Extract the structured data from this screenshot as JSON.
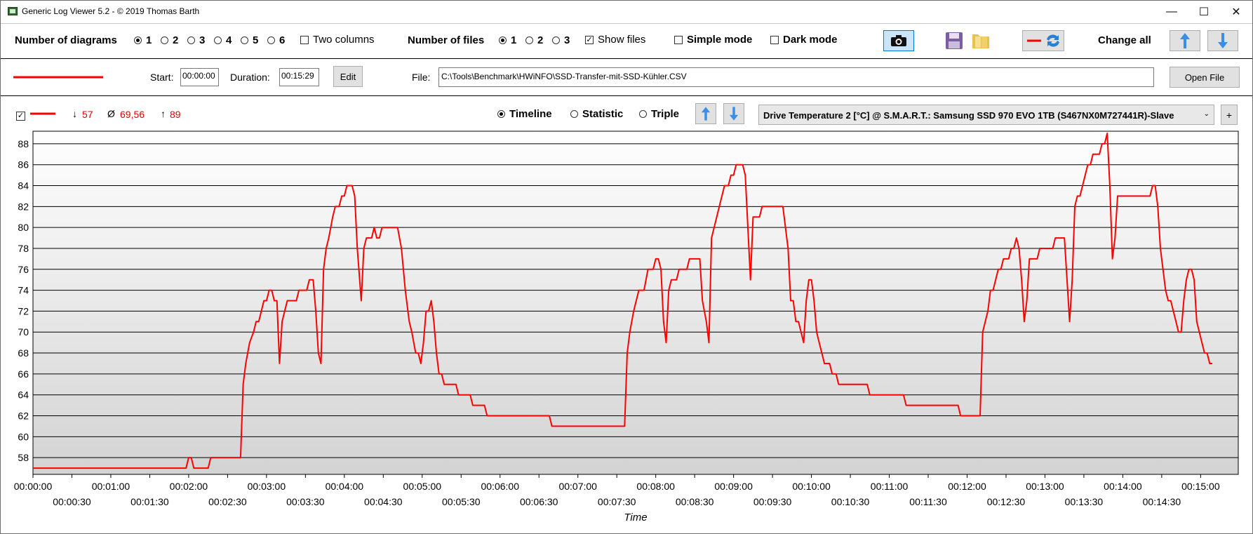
{
  "window": {
    "title": "Generic Log Viewer 5.2 - © 2019 Thomas Barth",
    "minimize": "—",
    "maximize": "☐",
    "close": "✕"
  },
  "toolbar": {
    "diagrams_label": "Number of diagrams",
    "diagram_options": [
      "1",
      "2",
      "3",
      "4",
      "5",
      "6"
    ],
    "diagram_selected": "1",
    "two_columns": "Two columns",
    "files_label": "Number of files",
    "file_options": [
      "1",
      "2",
      "3"
    ],
    "file_selected": "1",
    "show_files": "Show files",
    "simple_mode": "Simple mode",
    "dark_mode": "Dark mode",
    "change_all": "Change all",
    "icons": [
      "camera-icon",
      "save-icon",
      "folder-icon",
      "swap-color-icon",
      "arrow-up-icon",
      "arrow-down-icon"
    ]
  },
  "file_row": {
    "start_label": "Start:",
    "start_value": "00:00:00",
    "duration_label": "Duration:",
    "duration_value": "00:15:29",
    "edit": "Edit",
    "file_label": "File:",
    "file_path": "C:\\Tools\\Benchmark\\HWiNFO\\SSD-Transfer-mit-SSD-Kühler.CSV",
    "open_file": "Open File",
    "line_color": "#ff0000"
  },
  "series_row": {
    "min": "57",
    "avg": "69,56",
    "max": "89",
    "min_icon": "↓",
    "avg_icon": "Ø",
    "max_icon": "↑",
    "views": [
      "Timeline",
      "Statistic",
      "Triple"
    ],
    "view_selected": "Timeline",
    "sensor": "Drive Temperature 2 [°C] @ S.M.A.R.T.: Samsung SSD 970 EVO 1TB (S467NX0M727441R)-Slave",
    "add": "+"
  },
  "chart_data": {
    "type": "line",
    "xlabel": "Time",
    "ylabel": "",
    "ylim": [
      56.4,
      89.2
    ],
    "xlim_seconds": [
      0,
      929
    ],
    "y_ticks": [
      58,
      60,
      62,
      64,
      66,
      68,
      70,
      72,
      74,
      76,
      78,
      80,
      82,
      84,
      86,
      88
    ],
    "x_ticks_top": [
      "00:00:00",
      "00:01:00",
      "00:02:00",
      "00:03:00",
      "00:04:00",
      "00:05:00",
      "00:06:00",
      "00:07:00",
      "00:08:00",
      "00:09:00",
      "00:10:00",
      "00:11:00",
      "00:12:00",
      "00:13:00",
      "00:14:00",
      "00:15:00"
    ],
    "x_ticks_bottom": [
      "00:00:30",
      "00:01:30",
      "00:02:30",
      "00:03:30",
      "00:04:30",
      "00:05:30",
      "00:06:30",
      "00:07:30",
      "00:08:30",
      "00:09:30",
      "00:10:30",
      "00:11:30",
      "00:12:30",
      "00:13:30",
      "00:14:30"
    ],
    "grid": true,
    "series": [
      {
        "color": "#ff0000",
        "points": [
          [
            0,
            57
          ],
          [
            118,
            57
          ],
          [
            120,
            58
          ],
          [
            122,
            58
          ],
          [
            124,
            57
          ],
          [
            135,
            57
          ],
          [
            137,
            58
          ],
          [
            160,
            58
          ],
          [
            162,
            65
          ],
          [
            164,
            67
          ],
          [
            167,
            69
          ],
          [
            170,
            70
          ],
          [
            172,
            71
          ],
          [
            174,
            71
          ],
          [
            176,
            72
          ],
          [
            178,
            73
          ],
          [
            180,
            73
          ],
          [
            182,
            74
          ],
          [
            184,
            74
          ],
          [
            186,
            73
          ],
          [
            188,
            73
          ],
          [
            190,
            67
          ],
          [
            192,
            71
          ],
          [
            194,
            72
          ],
          [
            196,
            73
          ],
          [
            203,
            73
          ],
          [
            205,
            74
          ],
          [
            211,
            74
          ],
          [
            213,
            75
          ],
          [
            216,
            75
          ],
          [
            218,
            72
          ],
          [
            220,
            68
          ],
          [
            222,
            67
          ],
          [
            224,
            76
          ],
          [
            226,
            78
          ],
          [
            228,
            79
          ],
          [
            231,
            81
          ],
          [
            233,
            82
          ],
          [
            236,
            82
          ],
          [
            238,
            83
          ],
          [
            240,
            83
          ],
          [
            242,
            84
          ],
          [
            246,
            84
          ],
          [
            248,
            83
          ],
          [
            250,
            78
          ],
          [
            253,
            73
          ],
          [
            255,
            78
          ],
          [
            257,
            79
          ],
          [
            261,
            79
          ],
          [
            263,
            80
          ],
          [
            265,
            79
          ],
          [
            267,
            79
          ],
          [
            269,
            80
          ],
          [
            281,
            80
          ],
          [
            284,
            78
          ],
          [
            287,
            74
          ],
          [
            290,
            71
          ],
          [
            292,
            70
          ],
          [
            295,
            68
          ],
          [
            297,
            68
          ],
          [
            299,
            67
          ],
          [
            301,
            69
          ],
          [
            303,
            72
          ],
          [
            305,
            72
          ],
          [
            307,
            73
          ],
          [
            309,
            71
          ],
          [
            311,
            68
          ],
          [
            313,
            66
          ],
          [
            315,
            66
          ],
          [
            317,
            65
          ],
          [
            326,
            65
          ],
          [
            328,
            64
          ],
          [
            337,
            64
          ],
          [
            339,
            63
          ],
          [
            348,
            63
          ],
          [
            350,
            62
          ],
          [
            398,
            62
          ],
          [
            400,
            61
          ],
          [
            456,
            61
          ],
          [
            458,
            68
          ],
          [
            460,
            70
          ],
          [
            463,
            72
          ],
          [
            467,
            74
          ],
          [
            471,
            74
          ],
          [
            474,
            76
          ],
          [
            478,
            76
          ],
          [
            480,
            77
          ],
          [
            482,
            77
          ],
          [
            484,
            76
          ],
          [
            486,
            71
          ],
          [
            488,
            69
          ],
          [
            490,
            74
          ],
          [
            492,
            75
          ],
          [
            496,
            75
          ],
          [
            498,
            76
          ],
          [
            504,
            76
          ],
          [
            506,
            77
          ],
          [
            514,
            77
          ],
          [
            516,
            73
          ],
          [
            519,
            71
          ],
          [
            521,
            69
          ],
          [
            523,
            79
          ],
          [
            525,
            80
          ],
          [
            527,
            81
          ],
          [
            529,
            82
          ],
          [
            531,
            83
          ],
          [
            533,
            84
          ],
          [
            536,
            84
          ],
          [
            538,
            85
          ],
          [
            540,
            85
          ],
          [
            542,
            86
          ],
          [
            547,
            86
          ],
          [
            549,
            85
          ],
          [
            551,
            80
          ],
          [
            553,
            75
          ],
          [
            555,
            81
          ],
          [
            560,
            81
          ],
          [
            562,
            82
          ],
          [
            578,
            82
          ],
          [
            580,
            80
          ],
          [
            582,
            78
          ],
          [
            584,
            73
          ],
          [
            586,
            73
          ],
          [
            588,
            71
          ],
          [
            590,
            71
          ],
          [
            592,
            70
          ],
          [
            594,
            69
          ],
          [
            596,
            73
          ],
          [
            598,
            75
          ],
          [
            600,
            75
          ],
          [
            602,
            73
          ],
          [
            604,
            70
          ],
          [
            606,
            69
          ],
          [
            608,
            68
          ],
          [
            610,
            67
          ],
          [
            614,
            67
          ],
          [
            616,
            66
          ],
          [
            619,
            66
          ],
          [
            621,
            65
          ],
          [
            643,
            65
          ],
          [
            645,
            64
          ],
          [
            671,
            64
          ],
          [
            673,
            63
          ],
          [
            713,
            63
          ],
          [
            715,
            62
          ],
          [
            730,
            62
          ],
          [
            732,
            70
          ],
          [
            734,
            71
          ],
          [
            736,
            72
          ],
          [
            738,
            74
          ],
          [
            740,
            74
          ],
          [
            742,
            75
          ],
          [
            744,
            76
          ],
          [
            746,
            76
          ],
          [
            748,
            77
          ],
          [
            752,
            77
          ],
          [
            754,
            78
          ],
          [
            756,
            78
          ],
          [
            758,
            79
          ],
          [
            760,
            78
          ],
          [
            762,
            75
          ],
          [
            764,
            71
          ],
          [
            766,
            73
          ],
          [
            768,
            77
          ],
          [
            774,
            77
          ],
          [
            776,
            78
          ],
          [
            786,
            78
          ],
          [
            788,
            79
          ],
          [
            795,
            79
          ],
          [
            797,
            75
          ],
          [
            799,
            71
          ],
          [
            801,
            75
          ],
          [
            803,
            82
          ],
          [
            805,
            83
          ],
          [
            807,
            83
          ],
          [
            809,
            84
          ],
          [
            811,
            85
          ],
          [
            813,
            86
          ],
          [
            815,
            86
          ],
          [
            817,
            87
          ],
          [
            822,
            87
          ],
          [
            824,
            88
          ],
          [
            826,
            88
          ],
          [
            828,
            89
          ],
          [
            830,
            84
          ],
          [
            832,
            77
          ],
          [
            834,
            79
          ],
          [
            836,
            83
          ],
          [
            861,
            83
          ],
          [
            863,
            84
          ],
          [
            865,
            84
          ],
          [
            867,
            82
          ],
          [
            869,
            78
          ],
          [
            871,
            76
          ],
          [
            873,
            74
          ],
          [
            875,
            73
          ],
          [
            877,
            73
          ],
          [
            879,
            72
          ],
          [
            881,
            71
          ],
          [
            883,
            70
          ],
          [
            885,
            70
          ],
          [
            887,
            73
          ],
          [
            889,
            75
          ],
          [
            891,
            76
          ],
          [
            893,
            76
          ],
          [
            895,
            75
          ],
          [
            897,
            71
          ],
          [
            899,
            70
          ],
          [
            901,
            69
          ],
          [
            903,
            68
          ],
          [
            905,
            68
          ],
          [
            907,
            67
          ],
          [
            909,
            67
          ]
        ]
      }
    ]
  }
}
